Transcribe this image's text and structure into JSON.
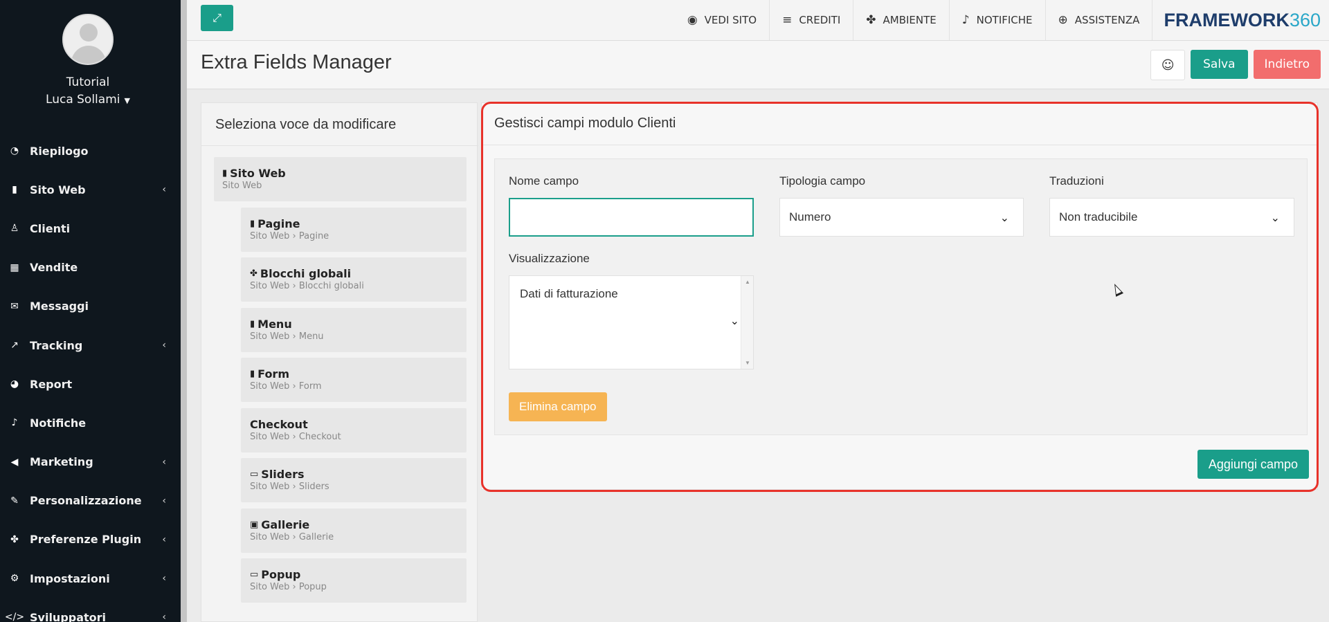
{
  "sidebar": {
    "user_role": "Tutorial",
    "user_name": "Luca Sollami",
    "items": [
      {
        "label": "Riepilogo",
        "icon": "dashboard-icon",
        "glyph": "◔",
        "has_sub": false
      },
      {
        "label": "Sito Web",
        "icon": "file-icon",
        "glyph": "▮",
        "has_sub": true
      },
      {
        "label": "Clienti",
        "icon": "person-icon",
        "glyph": "♙",
        "has_sub": false
      },
      {
        "label": "Vendite",
        "icon": "calculator-icon",
        "glyph": "▦",
        "has_sub": false
      },
      {
        "label": "Messaggi",
        "icon": "envelope-icon",
        "glyph": "✉",
        "has_sub": false
      },
      {
        "label": "Tracking",
        "icon": "line-chart-icon",
        "glyph": "↗",
        "has_sub": true
      },
      {
        "label": "Report",
        "icon": "pie-chart-icon",
        "glyph": "◕",
        "has_sub": false
      },
      {
        "label": "Notifiche",
        "icon": "bell-icon",
        "glyph": "♪",
        "has_sub": false
      },
      {
        "label": "Marketing",
        "icon": "megaphone-icon",
        "glyph": "◀",
        "has_sub": true
      },
      {
        "label": "Personalizzazione",
        "icon": "brush-icon",
        "glyph": "✎",
        "has_sub": true
      },
      {
        "label": "Preferenze Plugin",
        "icon": "cubes-icon",
        "glyph": "✤",
        "has_sub": true
      },
      {
        "label": "Impostazioni",
        "icon": "gear-icon",
        "glyph": "⚙",
        "has_sub": true
      },
      {
        "label": "Sviluppatori",
        "icon": "code-icon",
        "glyph": "</>",
        "has_sub": true
      }
    ]
  },
  "topbar": {
    "items": [
      {
        "label": "VEDI SITO",
        "icon": "eye-icon",
        "glyph": "◉"
      },
      {
        "label": "CREDITI",
        "icon": "coins-icon",
        "glyph": "≡"
      },
      {
        "label": "AMBIENTE",
        "icon": "cubes-icon",
        "glyph": "✤"
      },
      {
        "label": "NOTIFICHE",
        "icon": "bell-icon",
        "glyph": "♪"
      },
      {
        "label": "ASSISTENZA",
        "icon": "lifebuoy-icon",
        "glyph": "⊕"
      }
    ],
    "brand_part1": "FRAMEWORK",
    "brand_part2": "360"
  },
  "header": {
    "title": "Extra Fields Manager",
    "emoji_glyph": "☺",
    "save_label": "Salva",
    "back_label": "Indietro"
  },
  "tree": {
    "title": "Seleziona voce da modificare",
    "items": [
      {
        "title": "Sito Web",
        "subtitle": "Sito Web",
        "icon": "file-icon",
        "glyph": "▮",
        "level": 0
      },
      {
        "title": "Pagine",
        "subtitle": "Sito Web › Pagine",
        "icon": "file-icon",
        "glyph": "▮",
        "level": 1
      },
      {
        "title": "Blocchi globali",
        "subtitle": "Sito Web › Blocchi globali",
        "icon": "cubes-icon",
        "glyph": "✤",
        "level": 1
      },
      {
        "title": "Menu",
        "subtitle": "Sito Web › Menu",
        "icon": "file-icon",
        "glyph": "▮",
        "level": 1
      },
      {
        "title": "Form",
        "subtitle": "Sito Web › Form",
        "icon": "file-icon",
        "glyph": "▮",
        "level": 1
      },
      {
        "title": "Checkout",
        "subtitle": "Sito Web › Checkout",
        "icon": "",
        "glyph": "",
        "level": 1
      },
      {
        "title": "Sliders",
        "subtitle": "Sito Web › Sliders",
        "icon": "window-icon",
        "glyph": "▭",
        "level": 1
      },
      {
        "title": "Gallerie",
        "subtitle": "Sito Web › Gallerie",
        "icon": "image-icon",
        "glyph": "▣",
        "level": 1
      },
      {
        "title": "Popup",
        "subtitle": "Sito Web › Popup",
        "icon": "window-icon",
        "glyph": "▭",
        "level": 1
      }
    ]
  },
  "fields_panel": {
    "title": "Gestisci campi modulo Clienti",
    "name_label": "Nome campo",
    "name_value": "",
    "type_label": "Tipologia campo",
    "type_value": "Numero",
    "translations_label": "Traduzioni",
    "translations_value": "Non traducibile",
    "display_label": "Visualizzazione",
    "display_value": "Dati di fatturazione",
    "delete_label": "Elimina campo",
    "add_label": "Aggiungi campo"
  },
  "colors": {
    "accent": "#1a9e8a",
    "danger": "#f26d6d",
    "warning": "#f6b453",
    "highlight": "#e8322a",
    "sidebar_bg": "#0f171e"
  }
}
